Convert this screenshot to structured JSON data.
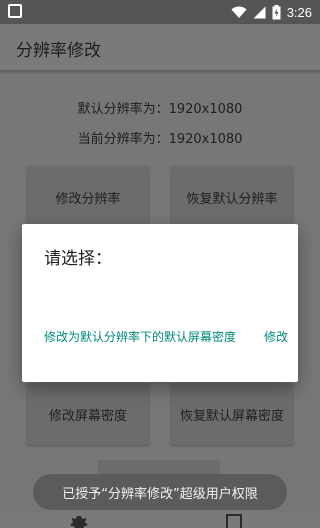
{
  "status_bar": {
    "time": "3:26",
    "icons": [
      "notification-icon",
      "wifi-icon",
      "signal-icon",
      "battery-charging-icon"
    ]
  },
  "app_bar": {
    "title": "分辨率修改"
  },
  "info": {
    "default_resolution": "默认分辨率为：1920x1080",
    "current_resolution": "当前分辨率为：1920x1080"
  },
  "buttons": {
    "modify_resolution": "修改分辨率",
    "restore_default_resolution": "恢复默认分辨率",
    "modify_density": "修改屏幕密度",
    "restore_default_density": "恢复默认屏幕密度"
  },
  "dialog": {
    "title": "请选择：",
    "action_primary": "修改为默认分辨率下的默认屏幕密度",
    "action_secondary": "修改"
  },
  "toast": {
    "message": "已授予“分辨率修改”超级用户权限"
  },
  "bottom_nav": {
    "icons": [
      "gear-icon",
      "info-icon"
    ]
  },
  "colors": {
    "dialog_action": "#00897b",
    "scrim_background": "#777777",
    "dialog_background": "#ffffff"
  }
}
